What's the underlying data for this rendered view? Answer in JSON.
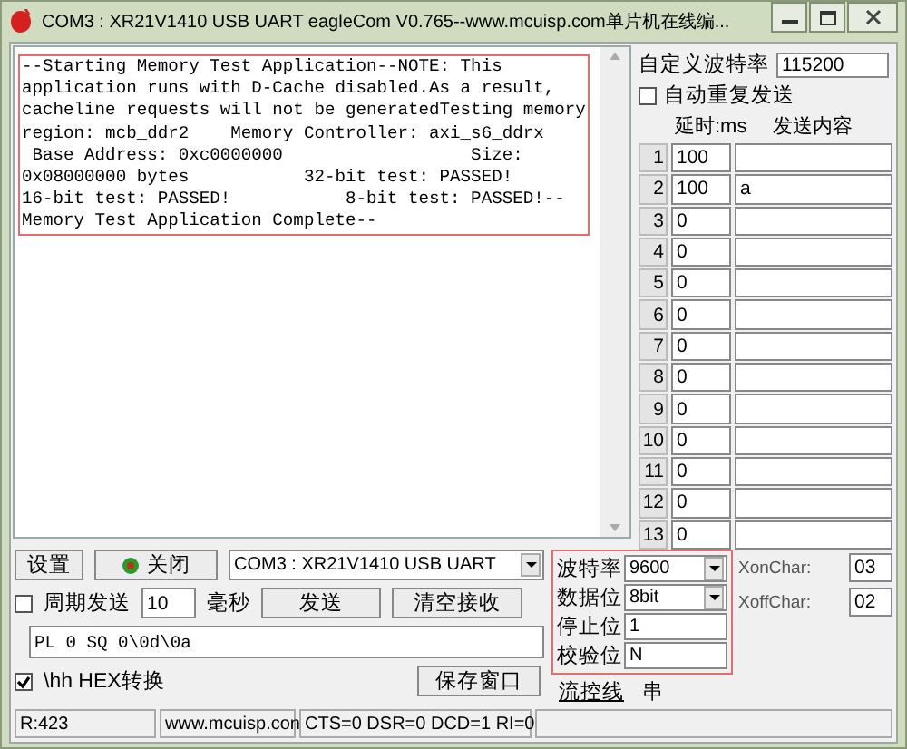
{
  "window": {
    "title": "COM3 : XR21V1410 USB UART  eagleCom V0.765--www.mcuisp.com单片机在线编..."
  },
  "output": {
    "lines": [
      "--Starting Memory Test Application--NOTE: This",
      "application runs with D-Cache disabled.As a result,",
      "cacheline requests will not be generatedTesting memory",
      "region: mcb_ddr2    Memory Controller: axi_s6_ddrx",
      " Base Address: 0xc0000000                  Size:",
      "0x08000000 bytes           32-bit test: PASSED!",
      "16-bit test: PASSED!           8-bit test: PASSED!--",
      "Memory Test Application Complete--"
    ]
  },
  "send_panel": {
    "custom_baud_label": "自定义波特率",
    "custom_baud_value": "115200",
    "auto_repeat": {
      "label": "自动重复发送",
      "checked": false
    },
    "columns": [
      "延时:ms",
      "发送内容"
    ],
    "rows": [
      {
        "index": "1",
        "delay": "100",
        "content": ""
      },
      {
        "index": "2",
        "delay": "100",
        "content": "a"
      },
      {
        "index": "3",
        "delay": "0",
        "content": ""
      },
      {
        "index": "4",
        "delay": "0",
        "content": ""
      },
      {
        "index": "5",
        "delay": "0",
        "content": ""
      },
      {
        "index": "6",
        "delay": "0",
        "content": ""
      },
      {
        "index": "7",
        "delay": "0",
        "content": ""
      },
      {
        "index": "8",
        "delay": "0",
        "content": ""
      },
      {
        "index": "9",
        "delay": "0",
        "content": ""
      },
      {
        "index": "10",
        "delay": "0",
        "content": ""
      },
      {
        "index": "11",
        "delay": "0",
        "content": ""
      },
      {
        "index": "12",
        "delay": "0",
        "content": ""
      },
      {
        "index": "13",
        "delay": "0",
        "content": ""
      }
    ]
  },
  "controls": {
    "settings_button": "设置",
    "port_button": {
      "label": "关闭",
      "open": true
    },
    "port_select": "COM3 : XR21V1410 USB UART",
    "periodic_send": {
      "label": "周期发送",
      "checked": false
    },
    "period_value": "10",
    "period_unit": "毫秒",
    "send_button": "发送",
    "clear_button": "清空接收",
    "send_input": "PL 0 SQ 0\\0d\\0a",
    "hex": {
      "label": "\\hh HEX转换",
      "checked": true
    },
    "save_button": "保存窗口"
  },
  "serial_settings": [
    {
      "label": "波特率",
      "value": "9600",
      "kind": "select"
    },
    {
      "label": "数据位",
      "value": "8bit",
      "kind": "select"
    },
    {
      "label": "停止位",
      "value": "1",
      "kind": "field"
    },
    {
      "label": "校验位",
      "value": "N",
      "kind": "field"
    }
  ],
  "flow_chars": [
    {
      "label": "XonChar:",
      "value": "03"
    },
    {
      "label": "XoffChar:",
      "value": "02"
    }
  ],
  "bottom_tabs": [
    {
      "label": "流控线",
      "selected": true
    },
    {
      "label": "串",
      "selected": false
    }
  ],
  "status_bar": [
    "R:423",
    "www.mcuisp.con",
    "CTS=0 DSR=0 DCD=1 RI=0"
  ]
}
